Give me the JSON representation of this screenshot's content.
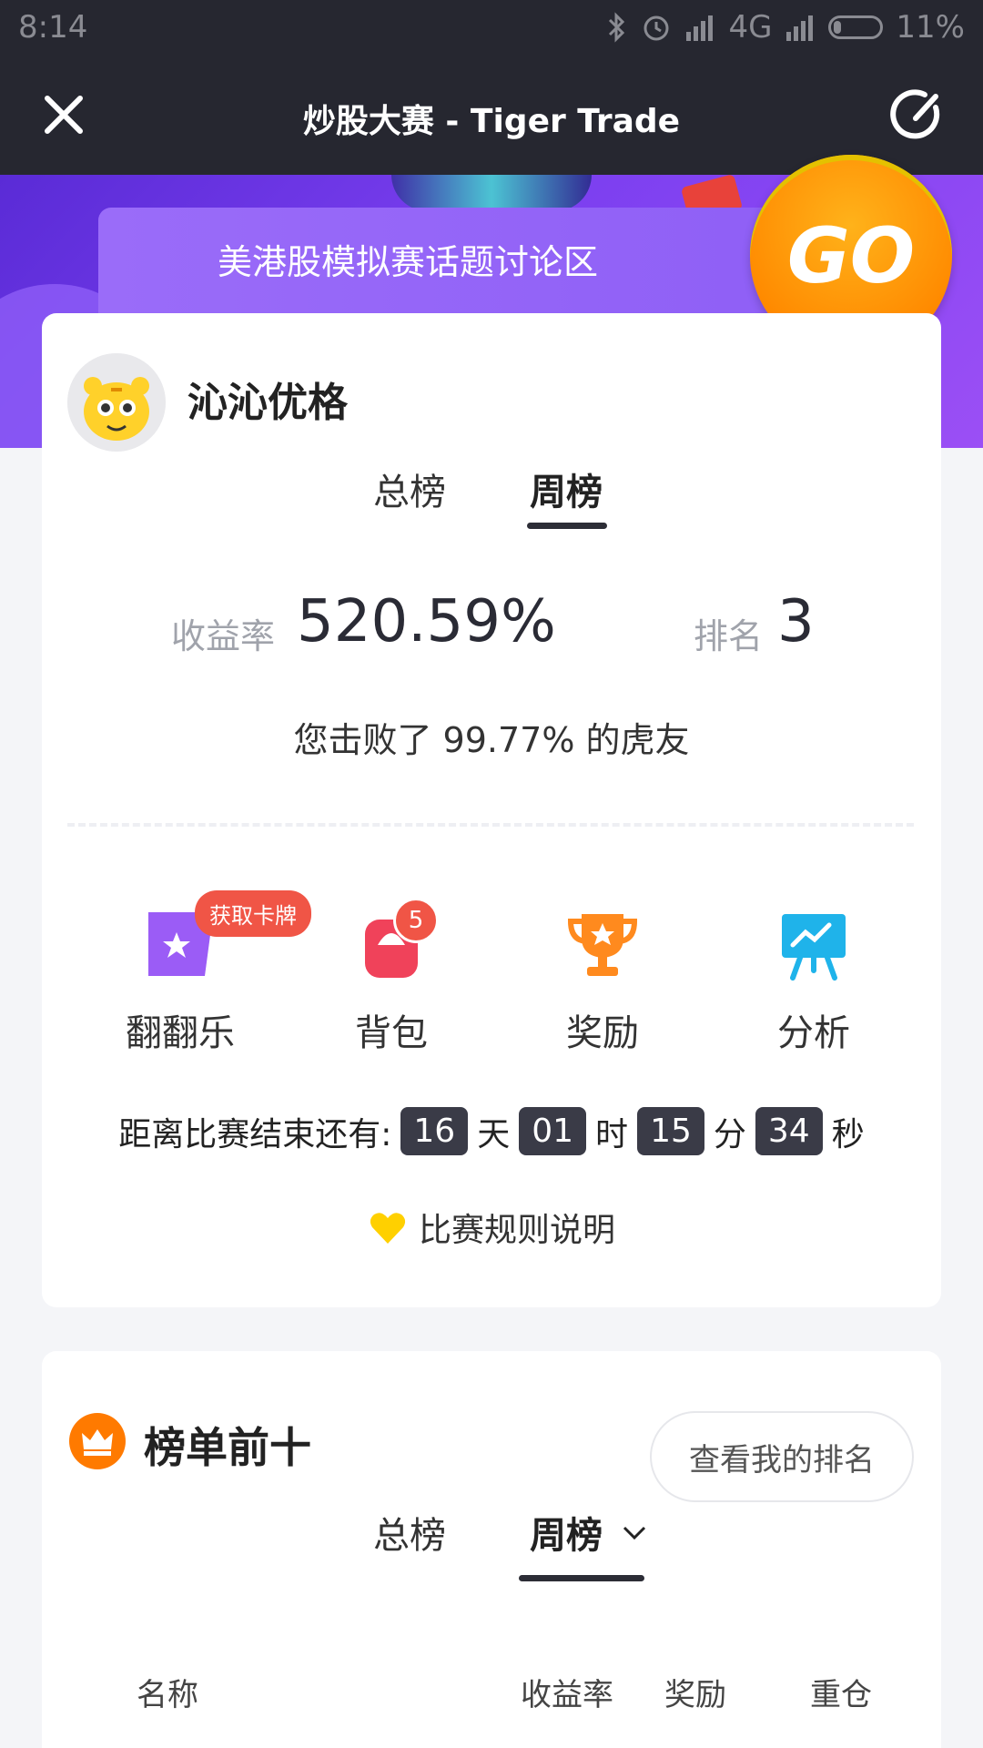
{
  "status_bar": {
    "time": "8:14",
    "network": "4G",
    "battery": "11%"
  },
  "nav": {
    "title": "炒股大赛 - Tiger Trade"
  },
  "banner": {
    "topic": "美港股模拟赛话题讨论区",
    "go_label": "GO"
  },
  "profile": {
    "username": "沁沁优格",
    "tabs": [
      {
        "label": "总榜"
      },
      {
        "label": "周榜"
      }
    ],
    "return_label": "收益率",
    "return_value": "520.59%",
    "rank_label": "排名",
    "rank_value": "3",
    "beat_text": "您击败了 99.77% 的虎友"
  },
  "features": [
    {
      "label": "翻翻乐",
      "tag": "获取卡牌"
    },
    {
      "label": "背包",
      "badge": "5"
    },
    {
      "label": "奖励"
    },
    {
      "label": "分析"
    }
  ],
  "countdown": {
    "prefix": "距离比赛结束还有:",
    "days": "16",
    "days_unit": "天",
    "hours": "01",
    "hours_unit": "时",
    "minutes": "15",
    "minutes_unit": "分",
    "seconds": "34",
    "seconds_unit": "秒"
  },
  "rules_link": "比赛规则说明",
  "leaderboard": {
    "title": "榜单前十",
    "my_rank_button": "查看我的排名",
    "tabs": [
      {
        "label": "总榜"
      },
      {
        "label": "周榜"
      }
    ],
    "columns": [
      "名称",
      "收益率",
      "奖励",
      "重仓"
    ]
  },
  "colors": {
    "bar": "#262730",
    "banner": "#7b3ff0",
    "accent": "#ff8a00",
    "badge": "#f05546",
    "countdown_box": "#3a3b47"
  }
}
